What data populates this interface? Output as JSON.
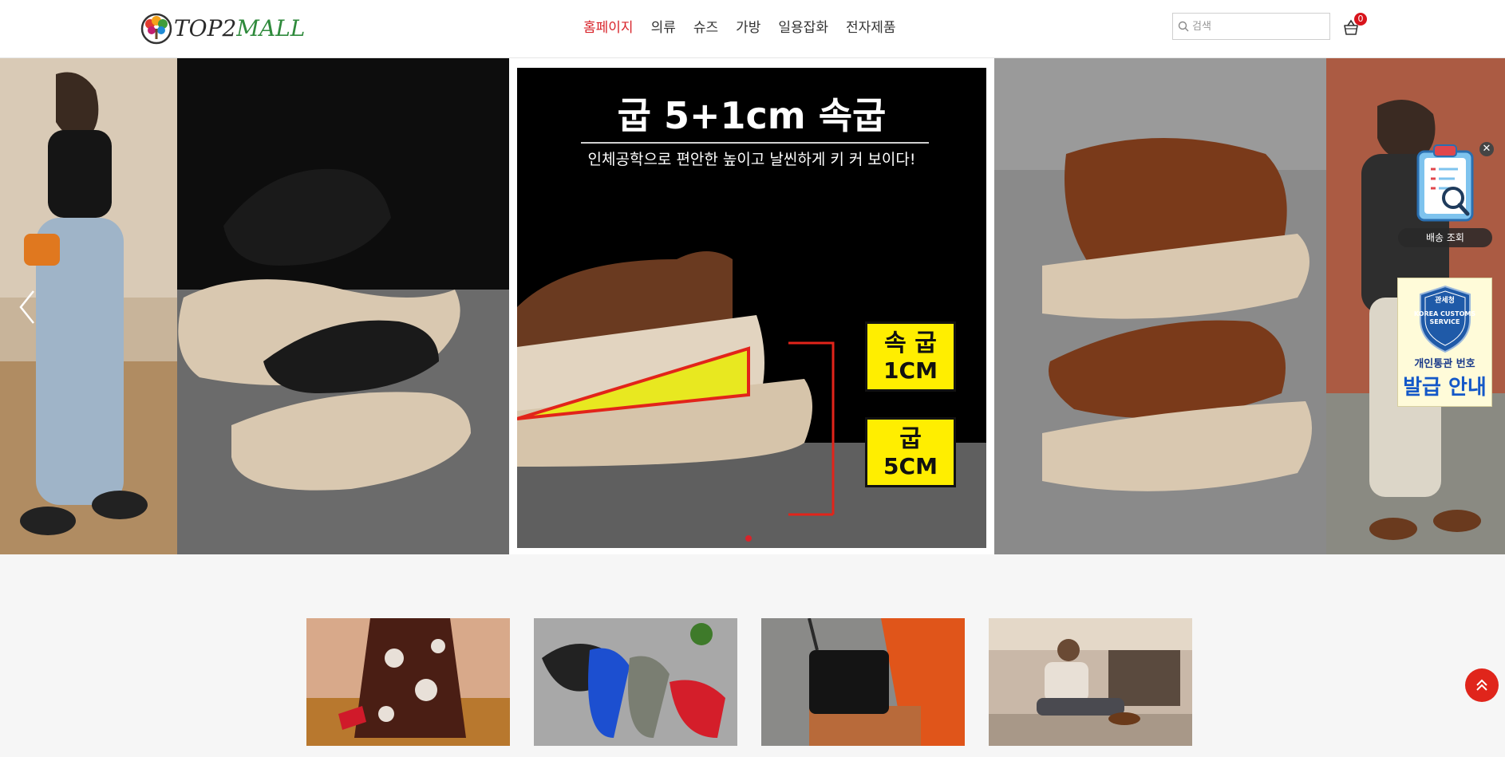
{
  "header": {
    "logo": {
      "text_part1": "TOP2",
      "text_part2": "MALL"
    },
    "nav": [
      {
        "label": "홈페이지",
        "active": true
      },
      {
        "label": "의류",
        "active": false
      },
      {
        "label": "슈즈",
        "active": false
      },
      {
        "label": "가방",
        "active": false
      },
      {
        "label": "일용잡화",
        "active": false
      },
      {
        "label": "전자제품",
        "active": false
      }
    ],
    "search": {
      "placeholder": "검색",
      "value": ""
    },
    "cart": {
      "count": "0"
    }
  },
  "banner": {
    "ad": {
      "headline": "굽 5+1cm 속굽",
      "subline": "인체공학으로 편안한 높이고 날씬하게 키 커 보이다!",
      "label_insole_1": "속 굽",
      "label_insole_2": "1CM",
      "label_heel_1": "굽",
      "label_heel_2": "5CM"
    },
    "slide_count": 1,
    "active_slide": 0
  },
  "widgets": {
    "delivery_label": "배송 조회",
    "customs": {
      "agency": "관세청",
      "agency_en": "KOREA CUSTOMS SERVICE",
      "line1": "개인통관 번호",
      "line2": "발급 안내"
    }
  },
  "categories": [
    {
      "icon": "skirt-photo"
    },
    {
      "icon": "sandals-photo"
    },
    {
      "icon": "bag-photo"
    },
    {
      "icon": "men-shoes-photo"
    }
  ],
  "colors": {
    "accent": "#d8232a",
    "logo_green": "#2f8a3c",
    "badge": "#d8141c",
    "page_bg": "#f6f6f6"
  }
}
